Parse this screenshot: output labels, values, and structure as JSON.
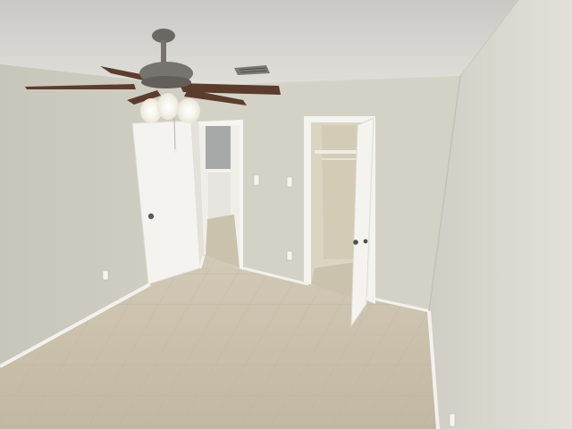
{
  "scene": {
    "kind": "empty bedroom interior photo",
    "colors": {
      "ceiling": "#d9d7d2",
      "left_wall": "#cfcdc2",
      "back_wall": "#d3d1c6",
      "right_wall": "#dcdad1",
      "floor": "#c9bfab",
      "baseboard": "#f3f1ec",
      "door": "#f4f2ee",
      "fan_blade": "#5a3a2c",
      "fan_metal": "#6b6763"
    },
    "objects": [
      "ceiling-fan-with-light",
      "air-vent",
      "open-bedroom-door",
      "hallway-opening",
      "walk-in-closet",
      "closet-door",
      "tile-floor",
      "electrical-outlets",
      "light-switches"
    ]
  }
}
